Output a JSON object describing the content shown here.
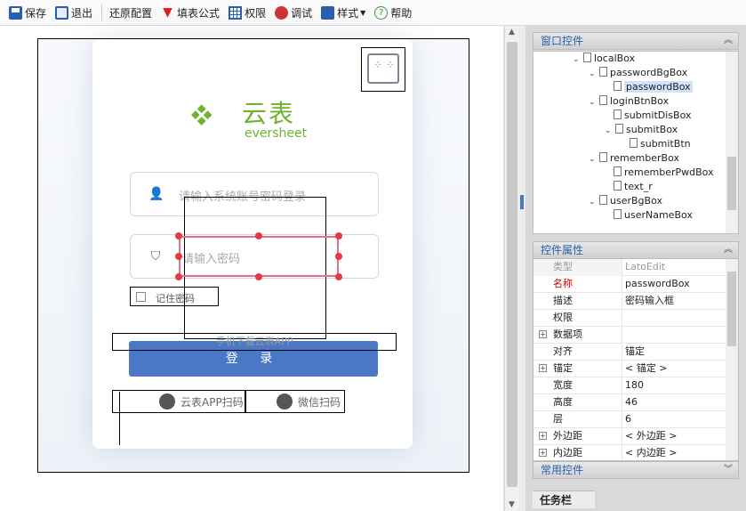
{
  "toolbar": {
    "save": "保存",
    "exit": "退出",
    "restore": "还原配置",
    "fill_formula": "填表公式",
    "permission": "权限",
    "debug": "调试",
    "style": "样式",
    "help": "帮助"
  },
  "login": {
    "logo_text": "云表",
    "logo_sub": "eversheet",
    "user_placeholder": "请输入系统账号密码登录",
    "pwd_placeholder": "请输入密码",
    "remember_label": "记住密码",
    "download_tip": "手机下载云表APP",
    "login_button": "登 录",
    "scan_app": "云表APP扫码",
    "scan_wechat": "微信扫码"
  },
  "window_controls": {
    "title": "窗口控件",
    "nodes": [
      {
        "label": "localBox"
      },
      {
        "label": "passwordBgBox"
      },
      {
        "label": "passwordBox",
        "selected": true
      },
      {
        "label": "loginBtnBox"
      },
      {
        "label": "submitDisBox"
      },
      {
        "label": "submitBox"
      },
      {
        "label": "submitBtn"
      },
      {
        "label": "rememberBox"
      },
      {
        "label": "rememberPwdBox"
      },
      {
        "label": "text_r"
      },
      {
        "label": "userBgBox"
      },
      {
        "label": "userNameBox"
      }
    ]
  },
  "properties": {
    "title": "控件属性",
    "rows": [
      {
        "key": "类型",
        "value": "LatoEdit"
      },
      {
        "key": "名称",
        "value": "passwordBox"
      },
      {
        "key": "描述",
        "value": "密码输入框"
      },
      {
        "key": "权限",
        "value": ""
      },
      {
        "key": "数据项",
        "value": ""
      },
      {
        "key": "对齐",
        "value": "锚定"
      },
      {
        "key": "锚定",
        "value": "< 锚定 >"
      },
      {
        "key": "宽度",
        "value": "180"
      },
      {
        "key": "高度",
        "value": "46"
      },
      {
        "key": "层",
        "value": "6"
      },
      {
        "key": "外边距",
        "value": "< 外边距 >"
      },
      {
        "key": "内边距",
        "value": "< 内边距 >"
      }
    ]
  },
  "common_controls": {
    "title": "常用控件"
  },
  "taskbar": {
    "label": "任务栏"
  }
}
